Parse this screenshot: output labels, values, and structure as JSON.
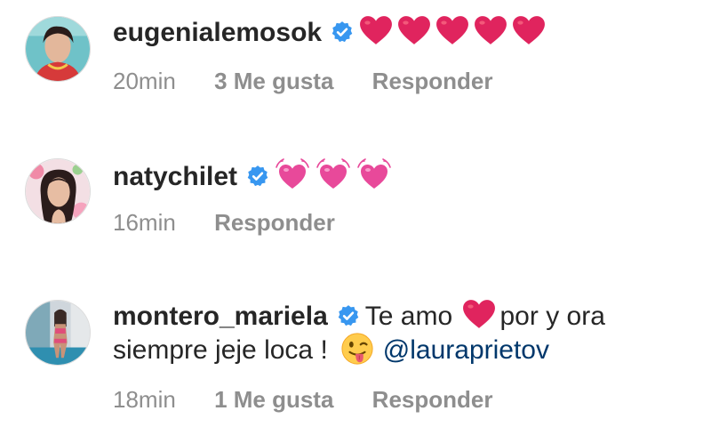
{
  "comments": [
    {
      "username": "eugenialemosok",
      "verified": true,
      "emoji_icons": [
        "red-heart-icon",
        "red-heart-icon",
        "red-heart-icon",
        "red-heart-icon",
        "red-heart-icon"
      ],
      "time": "20min",
      "likes": "3 Me gusta",
      "reply": "Responder"
    },
    {
      "username": "natychilet",
      "verified": true,
      "emoji_icons": [
        "pink-vibrating-heart-icon",
        "pink-vibrating-heart-icon",
        "pink-vibrating-heart-icon"
      ],
      "time": "16min",
      "reply": "Responder"
    },
    {
      "username": "montero_mariela",
      "verified": true,
      "text_part1": "Te amo",
      "text_part2": "por y ora",
      "text_line2": "siempre jeje loca !",
      "mention": "@lauraprietov",
      "time": "18min",
      "likes": "1 Me gusta",
      "reply": "Responder"
    }
  ],
  "colors": {
    "text": "#262626",
    "meta": "#8e8e8e",
    "mention": "#00376b",
    "verified_badge": "#3897f0",
    "heart_red": "#e0245e",
    "heart_pink": "#e8499a"
  }
}
